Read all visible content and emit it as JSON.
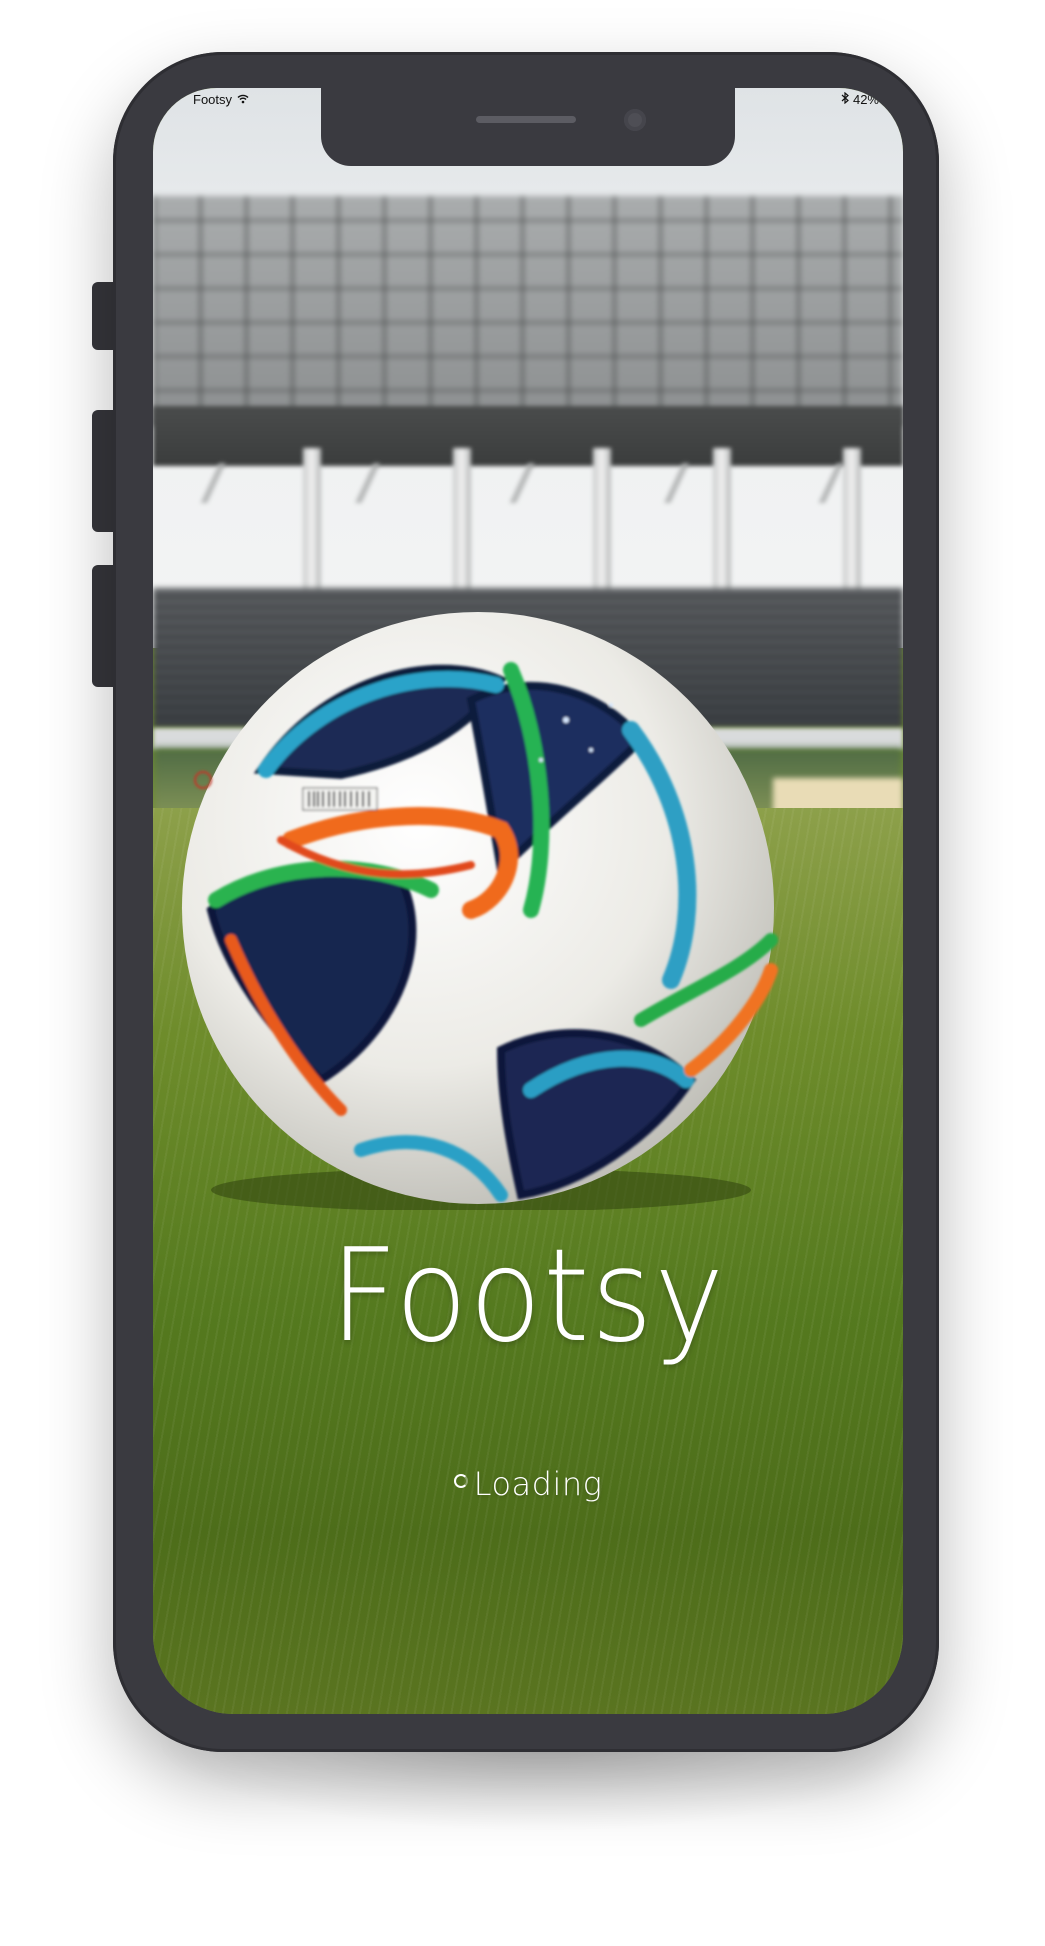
{
  "status_bar": {
    "carrier": "Footsy",
    "wifi_icon": "wifi-icon",
    "bluetooth_icon": "bluetooth-icon",
    "battery": "42%"
  },
  "splash": {
    "title": "Footsy",
    "loading_label": "Loading",
    "spinner_icon": "spinner-icon"
  },
  "background": {
    "subject": "football-on-stadium-grass"
  },
  "colors": {
    "device_frame": "#3a3a40",
    "title_text": "#ffffff"
  }
}
